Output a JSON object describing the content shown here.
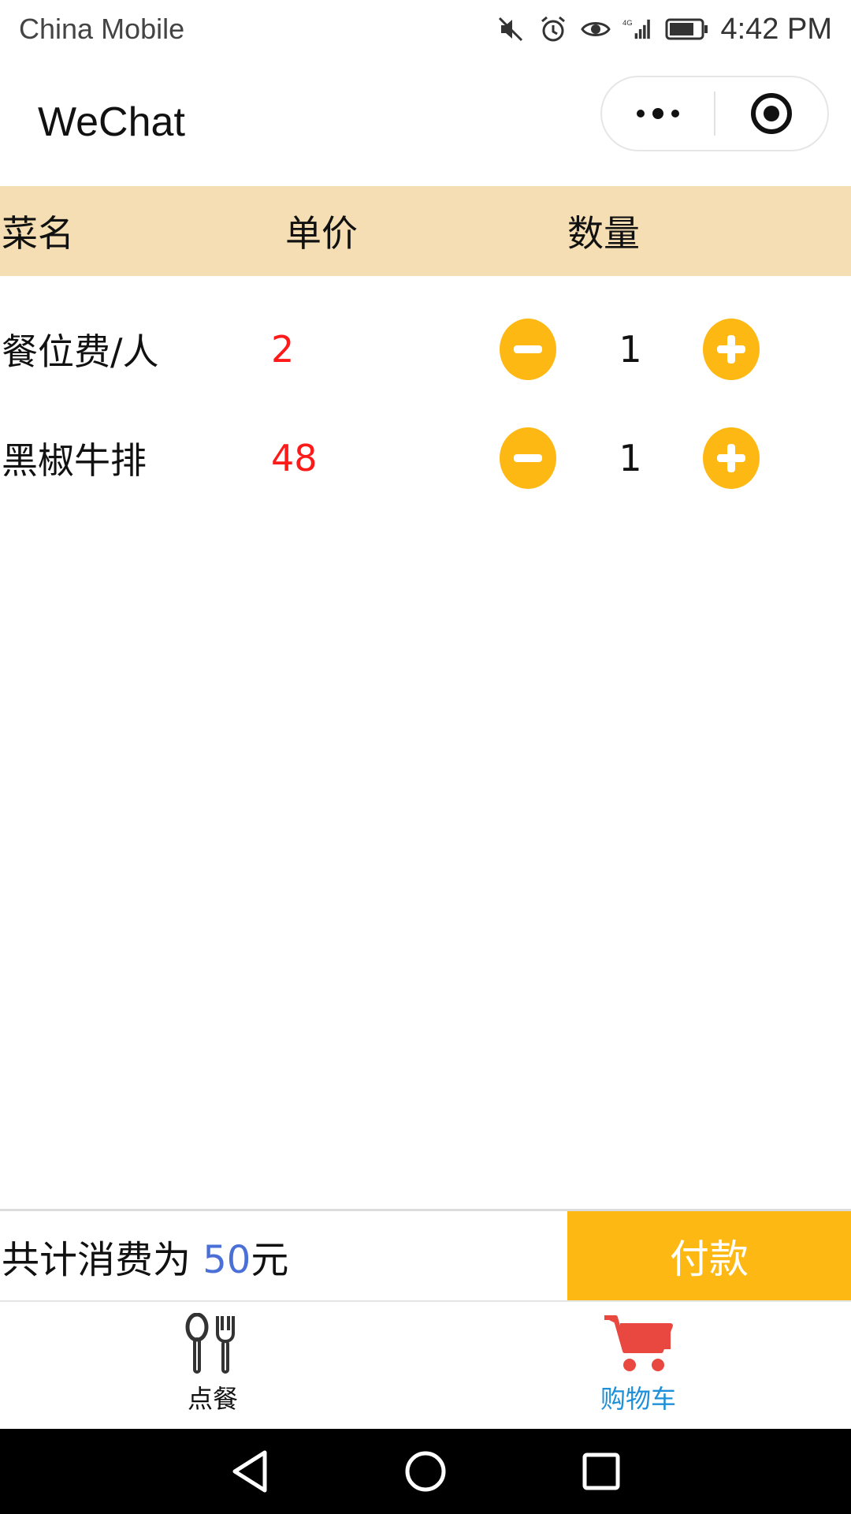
{
  "status_bar": {
    "carrier": "China Mobile",
    "time": "4:42 PM",
    "icons": [
      "mute-icon",
      "alarm-icon",
      "eye-icon",
      "signal-4g-icon",
      "battery-icon"
    ]
  },
  "title_bar": {
    "title": "WeChat",
    "capsule_icons": [
      "more-dots-icon",
      "target-close-icon"
    ]
  },
  "table": {
    "headers": {
      "name": "菜名",
      "price": "单价",
      "qty": "数量"
    },
    "rows": [
      {
        "name": "餐位费/人",
        "price": "2",
        "qty": "1"
      },
      {
        "name": "黑椒牛排",
        "price": "48",
        "qty": "1"
      }
    ]
  },
  "summary": {
    "total_prefix": "共计消费为 ",
    "total_amount": "50",
    "total_suffix": "元",
    "pay_label": "付款"
  },
  "tab_bar": {
    "tabs": [
      {
        "label": "点餐",
        "icon": "utensils-icon",
        "active": false
      },
      {
        "label": "购物车",
        "icon": "cart-icon",
        "active": true
      }
    ]
  },
  "colors": {
    "header_bg": "#f5deb3",
    "accent": "#fdb813",
    "price": "#ff1a1a",
    "total_amount": "#4a6fd6",
    "active_tab": "#1e90d9",
    "cart_icon": "#e8483f"
  },
  "nav_bar": {
    "icons": [
      "back-triangle-icon",
      "home-circle-icon",
      "recents-square-icon"
    ]
  }
}
